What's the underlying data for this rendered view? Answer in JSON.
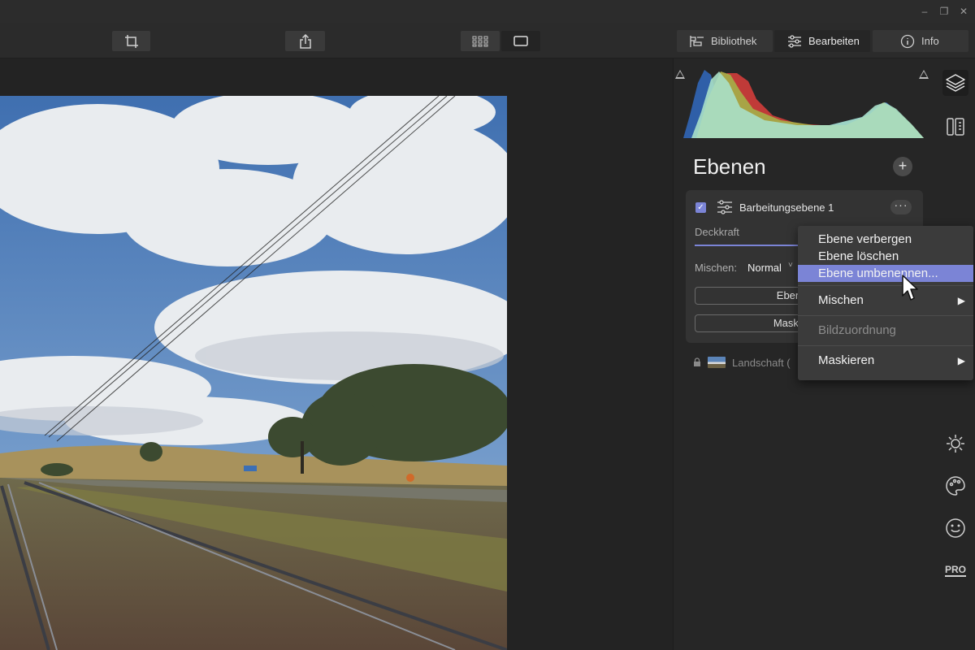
{
  "window": {
    "minimize": "–",
    "restore": "❐",
    "close": "✕"
  },
  "toolbar": {
    "crop_icon": "crop-icon",
    "share_icon": "share-icon",
    "grid_icon": "grid-view-icon",
    "single_icon": "single-view-icon",
    "library_label": "Bibliothek",
    "edit_label": "Bearbeiten",
    "info_label": "Info"
  },
  "panel": {
    "title": "Ebenen",
    "add": "+",
    "layer": {
      "checked": "✓",
      "name": "Barbeitungsebene 1",
      "more": "···",
      "opacity_label": "Deckkraft",
      "blend_label": "Mischen:",
      "blend_value": "Normal",
      "blend_chevron": "˅",
      "button1": "Ebene u",
      "button2": "Maske be"
    },
    "layer2_name": "Landschaft ("
  },
  "context_menu": {
    "items": [
      {
        "label": "Ebene verbergen"
      },
      {
        "label": "Ebene löschen"
      },
      {
        "label": "Ebene umbenennen..."
      },
      {
        "label": "Mischen",
        "submenu": "▶"
      },
      {
        "label": "Bildzuordnung"
      },
      {
        "label": "Maskieren",
        "submenu": "▶"
      }
    ]
  },
  "sidebar": {
    "icons": [
      "layers-icon",
      "presets-icon",
      "sun-icon",
      "palette-icon",
      "face-icon",
      "pro-icon"
    ],
    "pro_label": "PRO"
  },
  "colors": {
    "accent": "#7b84d6",
    "panel": "#262626",
    "menu": "#3b3b3b"
  }
}
